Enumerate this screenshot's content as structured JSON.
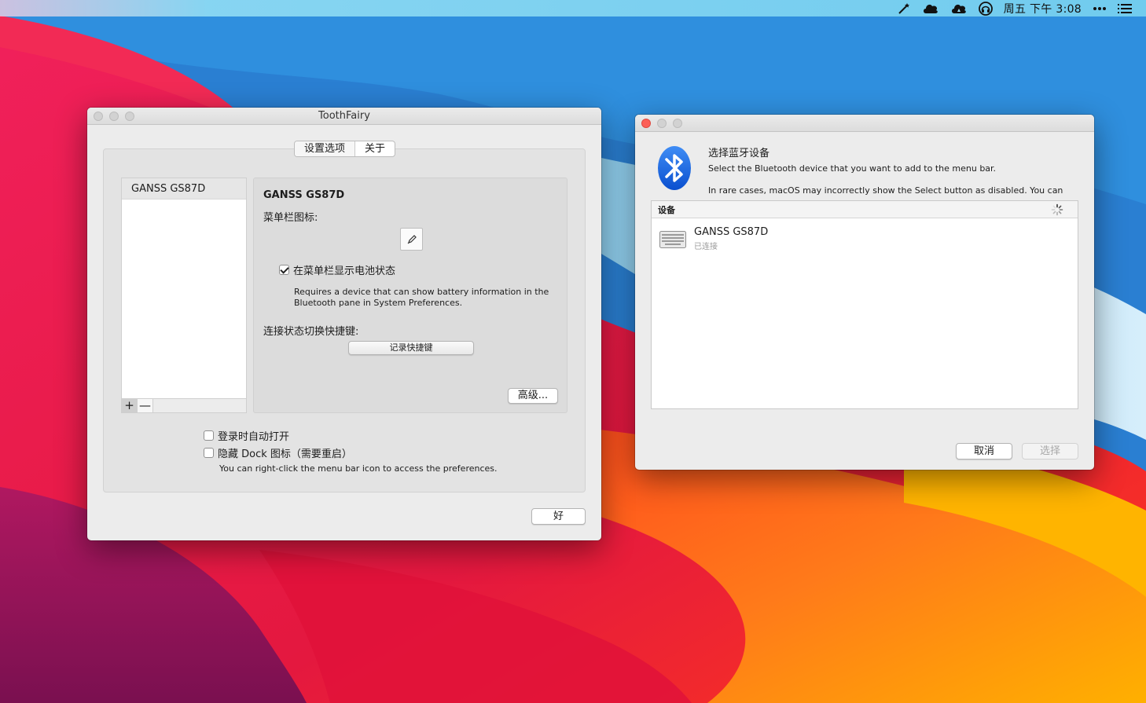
{
  "menubar": {
    "icons": [
      "magic-wand-icon",
      "cloud-icon",
      "cloud-sync-icon",
      "headphones-icon",
      "more-icon",
      "list-icon"
    ],
    "clock": "周五 下午 3:08"
  },
  "toothfairy": {
    "title": "ToothFairy",
    "tabs": [
      {
        "label": "设置选项",
        "selected": true
      },
      {
        "label": "关于",
        "selected": false
      }
    ],
    "device_list": [
      "GANSS  GS87D"
    ],
    "add_label": "+",
    "remove_label": "—",
    "detail": {
      "device_name": "GANSS  GS87D",
      "menu_icon_label": "菜单栏图标:",
      "icon_button_icon": "pencil-icon",
      "show_battery_label": "在菜单栏显示电池状态",
      "show_battery_checked": true,
      "battery_note": "Requires a device that can show battery information in the Bluetooth pane in System Preferences.",
      "shortcut_label": "连接状态切换快捷键:",
      "record_shortcut_label": "记录快捷键",
      "advanced_label": "高级..."
    },
    "login_open_label": "登录时自动打开",
    "login_open_checked": false,
    "hide_dock_label": "隐藏 Dock 图标（需要重启）",
    "hide_dock_checked": false,
    "right_click_note": "You can right-click the menu bar icon to access the preferences.",
    "ok_label": "好"
  },
  "bt_picker": {
    "title": "选择蓝牙设备",
    "description": "Select the Bluetooth device that you want to add to the menu bar.",
    "description2": "In rare cases, macOS may incorrectly show the Select button as disabled. You can click Cancel and then Option-click the + button to add the device manually.",
    "column_header": "设备",
    "devices": [
      {
        "name": "GANSS  GS87D",
        "status": "已连接",
        "icon": "keyboard-icon"
      }
    ],
    "cancel_label": "取消",
    "select_label": "选择",
    "select_enabled": false
  }
}
